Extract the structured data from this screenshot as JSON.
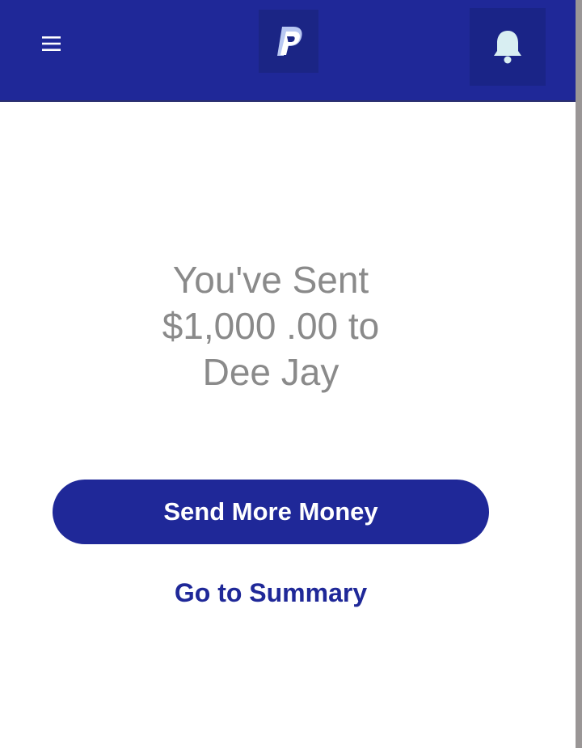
{
  "header": {
    "menu_icon": "hamburger-menu-icon",
    "logo_icon": "paypal-logo-icon",
    "notification_icon": "bell-icon",
    "brand_color": "#1f2898"
  },
  "confirmation": {
    "line1": "You've Sent",
    "line2": "$1,000 .00 to",
    "line3": "Dee Jay",
    "text_color": "#8a8a8a"
  },
  "actions": {
    "send_more_label": "Send More Money",
    "go_to_summary_label": "Go to Summary"
  }
}
